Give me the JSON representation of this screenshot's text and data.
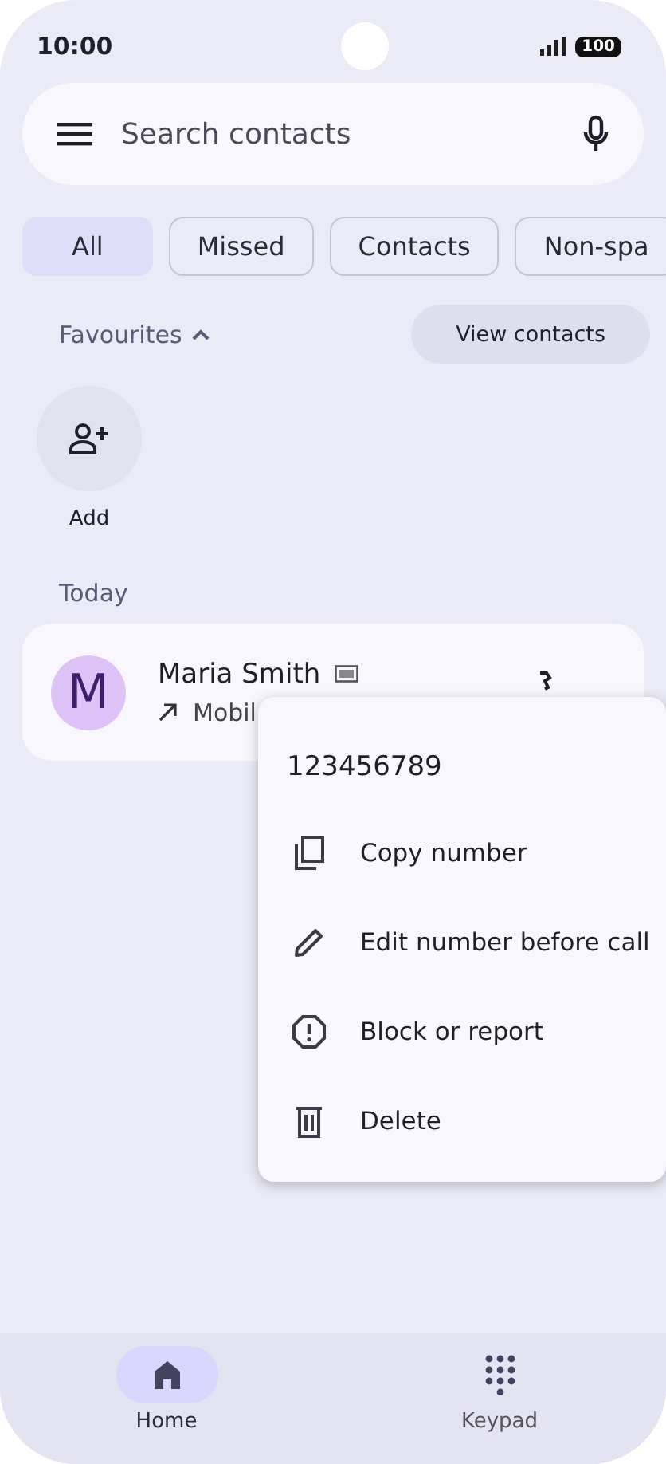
{
  "status_bar": {
    "time": "10:00",
    "battery": "100"
  },
  "search": {
    "placeholder": "Search contacts"
  },
  "filters": [
    {
      "label": "All",
      "selected": true
    },
    {
      "label": "Missed",
      "selected": false
    },
    {
      "label": "Contacts",
      "selected": false
    },
    {
      "label": "Non-spa",
      "selected": false
    }
  ],
  "favourites": {
    "title": "Favourites",
    "expanded": true,
    "button": "View contacts",
    "add_label": "Add"
  },
  "recents": {
    "title": "Today",
    "calls": [
      {
        "initial": "M",
        "name": "Maria Smith",
        "type": "Mobil",
        "color": "#dcc2f7"
      }
    ]
  },
  "menu": {
    "number": "123456789",
    "items": [
      {
        "kind": "copy",
        "label": "Copy number"
      },
      {
        "kind": "edit",
        "label": "Edit number before call"
      },
      {
        "kind": "block",
        "label": "Block or report"
      },
      {
        "kind": "delete",
        "label": "Delete"
      }
    ]
  },
  "nav": [
    {
      "kind": "home",
      "label": "Home",
      "selected": true
    },
    {
      "kind": "keypad",
      "label": "Keypad",
      "selected": false
    }
  ]
}
